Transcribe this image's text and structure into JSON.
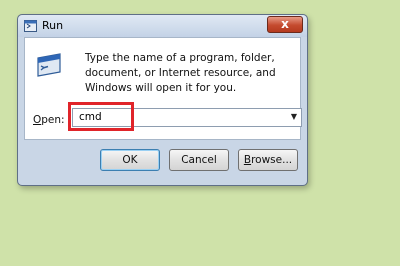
{
  "window": {
    "title": "Run",
    "close_glyph": "x"
  },
  "dialog": {
    "description": "Type the name of a program, folder, document, or Internet resource, and Windows will open it for you.",
    "open_label_accel": "O",
    "open_label_rest": "pen:",
    "input_value": "cmd",
    "dropdown_glyph": "▼"
  },
  "buttons": {
    "ok": "OK",
    "cancel": "Cancel",
    "browse_accel": "B",
    "browse_rest": "rowse..."
  },
  "colors": {
    "background": "#cfe2a9",
    "highlight": "#e0242a",
    "close_button": "#c44a2e"
  },
  "icons": {
    "title": "run-icon",
    "dialog": "run-program-icon"
  }
}
